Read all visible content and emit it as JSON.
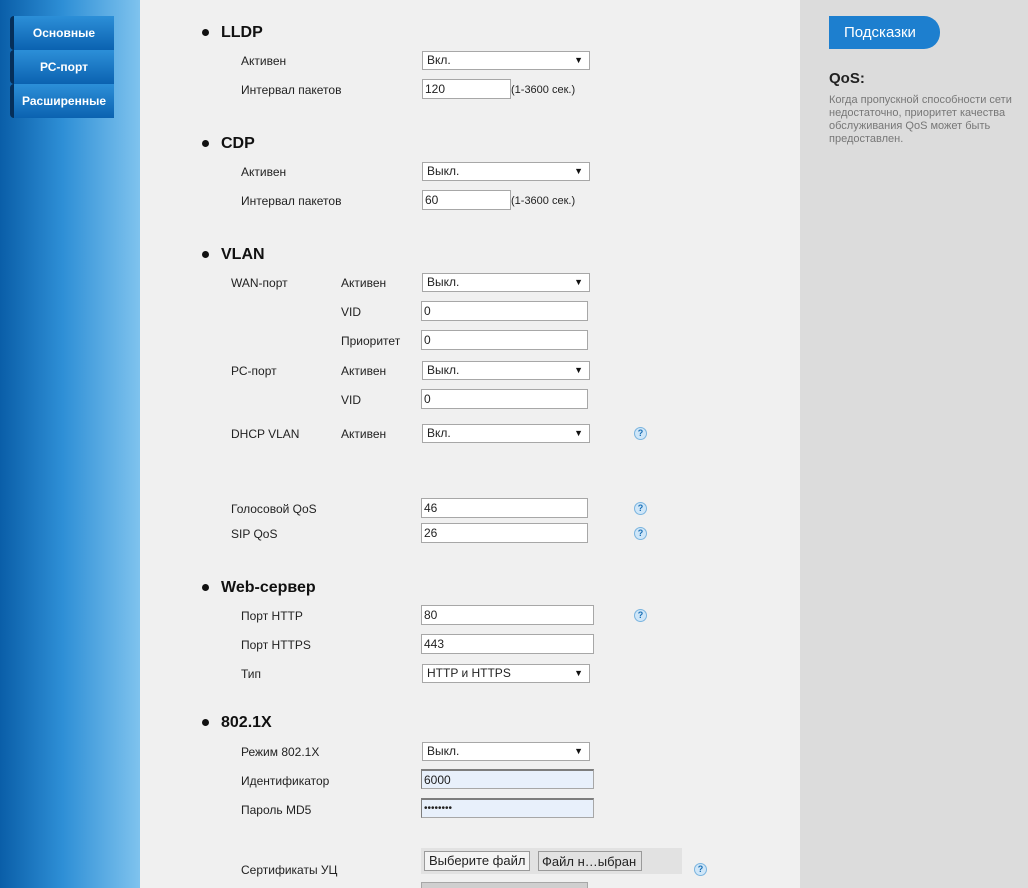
{
  "sidebar": {
    "items": [
      {
        "label": "Основные"
      },
      {
        "label": "РС-порт"
      },
      {
        "label": "Расширенные"
      }
    ]
  },
  "lldp": {
    "title": "LLDP",
    "active_label": "Активен",
    "active_value": "Вкл.",
    "interval_label": "Интервал пакетов",
    "interval_value": "120",
    "interval_hint": "(1-3600 сек.)"
  },
  "cdp": {
    "title": "CDP",
    "active_label": "Активен",
    "active_value": "Выкл.",
    "interval_label": "Интервал пакетов",
    "interval_value": "60",
    "interval_hint": "(1-3600 сек.)"
  },
  "vlan": {
    "title": "VLAN",
    "wan_label": "WAN-порт",
    "wan_active_label": "Активен",
    "wan_active_value": "Выкл.",
    "wan_vid_label": "VID",
    "wan_vid_value": "0",
    "wan_priority_label": "Приоритет",
    "wan_priority_value": "0",
    "pc_label": "РС-порт",
    "pc_active_label": "Активен",
    "pc_active_value": "Выкл.",
    "pc_vid_label": "VID",
    "pc_vid_value": "0",
    "dhcp_label": "DHCP VLAN",
    "dhcp_active_label": "Активен",
    "dhcp_active_value": "Вкл.",
    "voice_qos_label": "Голосовой QoS",
    "voice_qos_value": "46",
    "sip_qos_label": "SIP QoS",
    "sip_qos_value": "26"
  },
  "web": {
    "title": "Web-сервер",
    "http_label": "Порт HTTP",
    "http_value": "80",
    "https_label": "Порт HTTPS",
    "https_value": "443",
    "type_label": "Тип",
    "type_value": "HTTP и HTTPS"
  },
  "dot1x": {
    "title": "802.1X",
    "mode_label": "Режим 802.1X",
    "mode_value": "Выкл.",
    "id_label": "Идентификатор",
    "id_value": "6000",
    "pwd_label": "Пароль MD5",
    "pwd_value": "••••••••",
    "cert_label": "Сертификаты УЦ",
    "choose_button": "Выберите файл",
    "no_file": "Файл н…ыбран"
  },
  "help_glyph": "?",
  "arrow_glyph": "▼",
  "hints": {
    "tab": "Подсказки",
    "title": "QoS:",
    "text": "Когда пропускной способности сети недостаточно, приоритет качества обслуживания QoS может быть предоставлен."
  }
}
